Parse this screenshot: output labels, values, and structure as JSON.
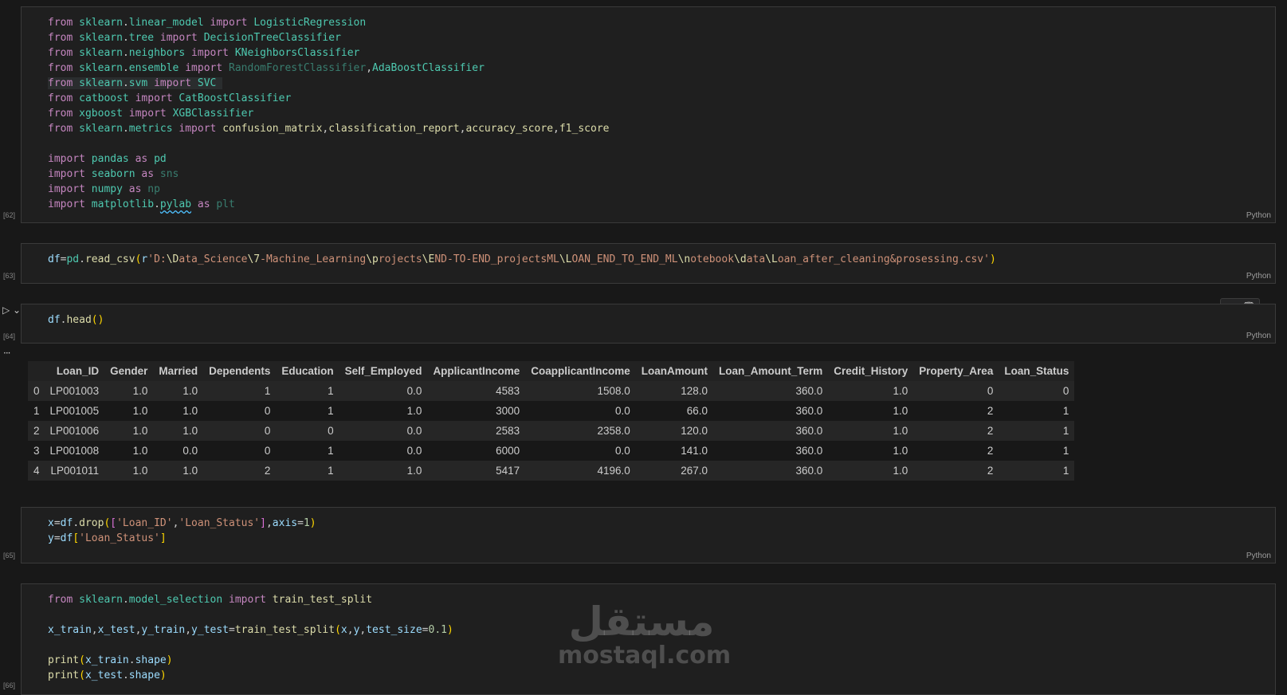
{
  "cells": [
    {
      "count": "[62]",
      "lang": "Python"
    },
    {
      "count": "[63]",
      "lang": "Python"
    },
    {
      "count": "[64]",
      "lang": "Python"
    },
    {
      "count": "[65]",
      "lang": "Python"
    },
    {
      "count": "[66]",
      "lang": "Python"
    }
  ],
  "toolbar": {
    "more": "···",
    "delete": "🗑"
  },
  "output_more": "···",
  "table": {
    "columns": [
      "",
      "Loan_ID",
      "Gender",
      "Married",
      "Dependents",
      "Education",
      "Self_Employed",
      "ApplicantIncome",
      "CoapplicantIncome",
      "LoanAmount",
      "Loan_Amount_Term",
      "Credit_History",
      "Property_Area",
      "Loan_Status"
    ],
    "rows": [
      [
        "0",
        "LP001003",
        "1.0",
        "1.0",
        "1",
        "1",
        "0.0",
        "4583",
        "1508.0",
        "128.0",
        "360.0",
        "1.0",
        "0",
        "0"
      ],
      [
        "1",
        "LP001005",
        "1.0",
        "1.0",
        "0",
        "1",
        "1.0",
        "3000",
        "0.0",
        "66.0",
        "360.0",
        "1.0",
        "2",
        "1"
      ],
      [
        "2",
        "LP001006",
        "1.0",
        "1.0",
        "0",
        "0",
        "0.0",
        "2583",
        "2358.0",
        "120.0",
        "360.0",
        "1.0",
        "2",
        "1"
      ],
      [
        "3",
        "LP001008",
        "1.0",
        "0.0",
        "0",
        "1",
        "0.0",
        "6000",
        "0.0",
        "141.0",
        "360.0",
        "1.0",
        "2",
        "1"
      ],
      [
        "4",
        "LP001011",
        "1.0",
        "1.0",
        "2",
        "1",
        "1.0",
        "5417",
        "4196.0",
        "267.0",
        "360.0",
        "1.0",
        "2",
        "1"
      ]
    ]
  },
  "watermark": {
    "logo": "مستقل",
    "text": "mostaql.com"
  }
}
